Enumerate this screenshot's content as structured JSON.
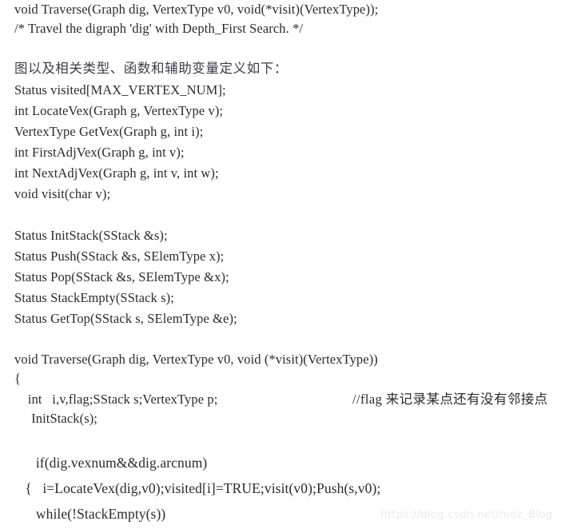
{
  "document": {
    "type": "code-listing",
    "language": "C",
    "background_color": "#ffffff",
    "text_color": "#2b2b2b",
    "watermark_color": "#e9eaec"
  },
  "lines": {
    "l1": "void Traverse(Graph dig, VertexType v0, void(*visit)(VertexType));",
    "l2": "/* Travel the digraph 'dig' with Depth_First Search. */",
    "l3": "图以及相关类型、函数和辅助变量定义如下：",
    "l4": "Status visited[MAX_VERTEX_NUM];",
    "l5": "int LocateVex(Graph g, VertexType v);",
    "l6": "VertexType GetVex(Graph g, int i);",
    "l7": "int FirstAdjVex(Graph g, int v);",
    "l8": "int NextAdjVex(Graph g, int v, int w);",
    "l9": "void visit(char v);",
    "l10": "Status InitStack(SStack &s);",
    "l11": "Status Push(SStack &s, SElemType x);",
    "l12": "Status Pop(SStack &s, SElemType &x);",
    "l13": "Status StackEmpty(SStack s);",
    "l14": "Status GetTop(SStack s, SElemType &e);",
    "l15": "void Traverse(Graph dig, VertexType v0, void (*visit)(VertexType))",
    "l16": "{",
    "l17": "    int   i,v,flag;SStack s;VertexType p;",
    "l17_comment": "//flag 来记录某点还有没有邻接点",
    "l18": "     InitStack(s);",
    "l19": "      if(dig.vexnum&&dig.arcnum)",
    "l20": "   {   i=LocateVex(dig,v0);visited[i]=TRUE;visit(v0);Push(s,v0);",
    "l21": "      while(!StackEmpty(s))"
  },
  "watermark": {
    "text": "https://blog.csdn.net/mez_Blog"
  }
}
